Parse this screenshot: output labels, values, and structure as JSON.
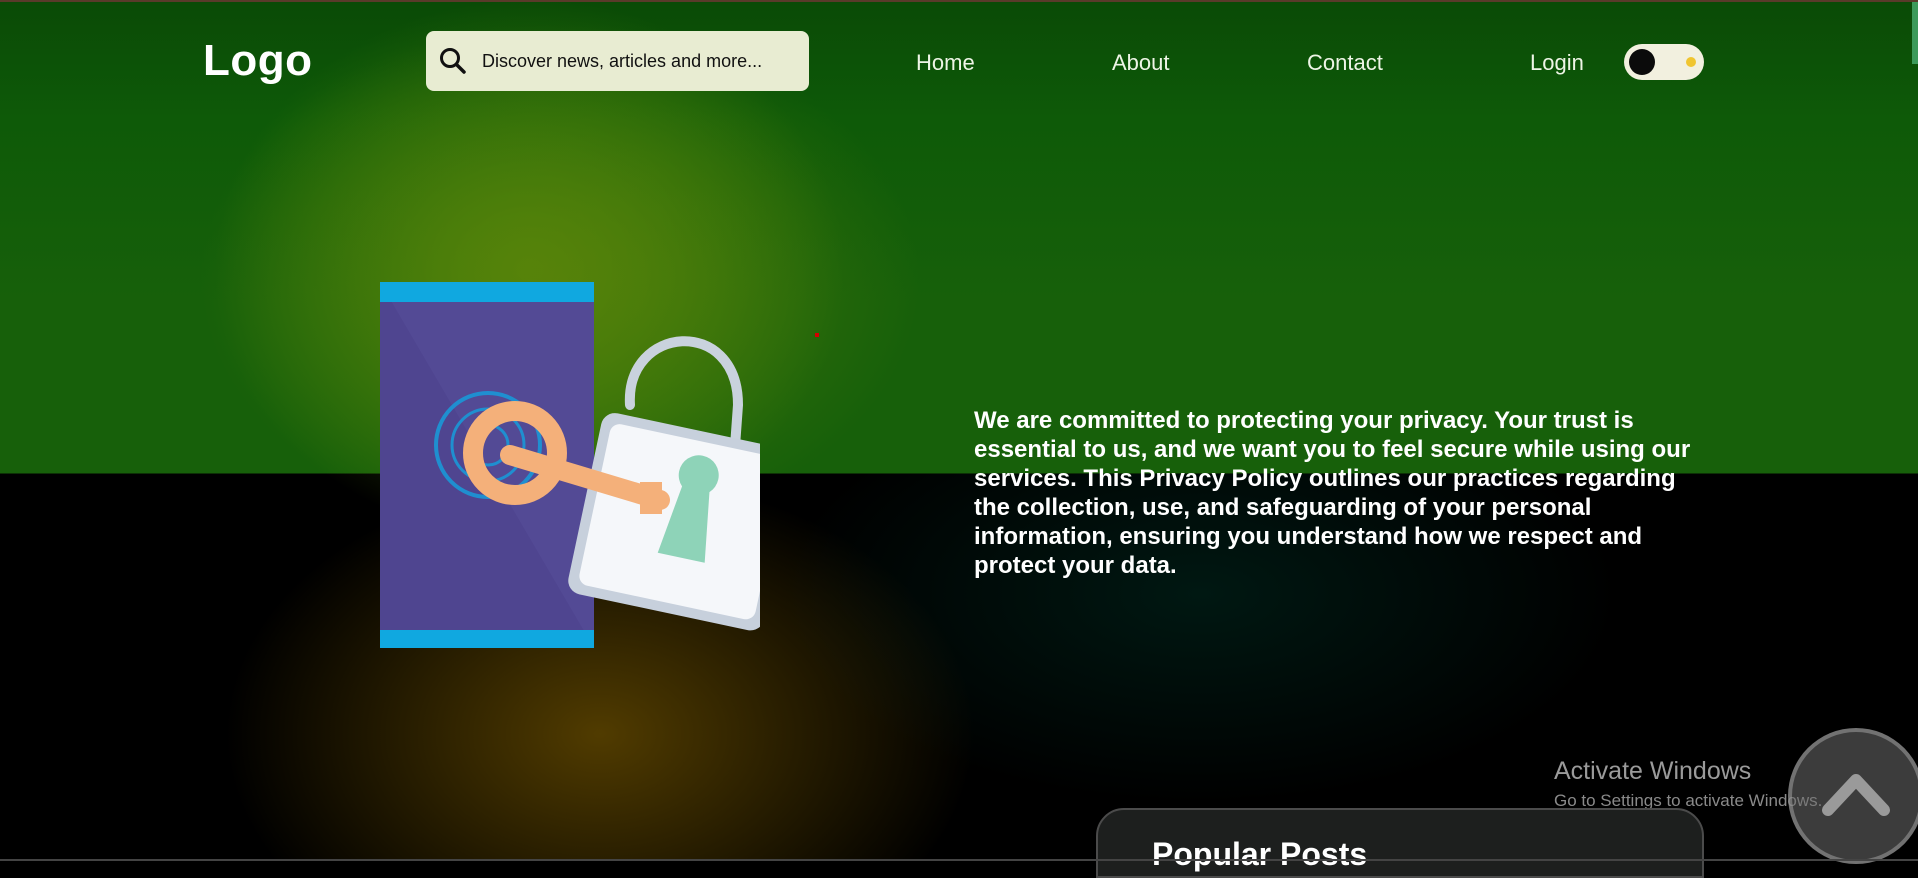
{
  "header": {
    "logo": "Logo",
    "search_placeholder": "Discover news, articles and more...",
    "nav": [
      "Home",
      "About",
      "Contact"
    ],
    "login": "Login"
  },
  "hero": {
    "text": "We are committed to protecting your privacy. Your trust is essential to us, and we want you to feel secure while using our services. This Privacy Policy outlines our practices regarding the collection, use, and safeguarding of your personal information, ensuring you understand how we respect and protect your data."
  },
  "popular": {
    "title": "Popular Posts"
  },
  "watermark": {
    "title": "Activate Windows",
    "subtitle": "Go to Settings to activate Windows."
  },
  "icons": [
    "search-icon",
    "phone-lock-illustration",
    "chevron-up-icon"
  ],
  "colors": {
    "header_green": "#0e5a08",
    "search_bg": "#e8ecd2",
    "toggle_dot": "#f0c530"
  }
}
